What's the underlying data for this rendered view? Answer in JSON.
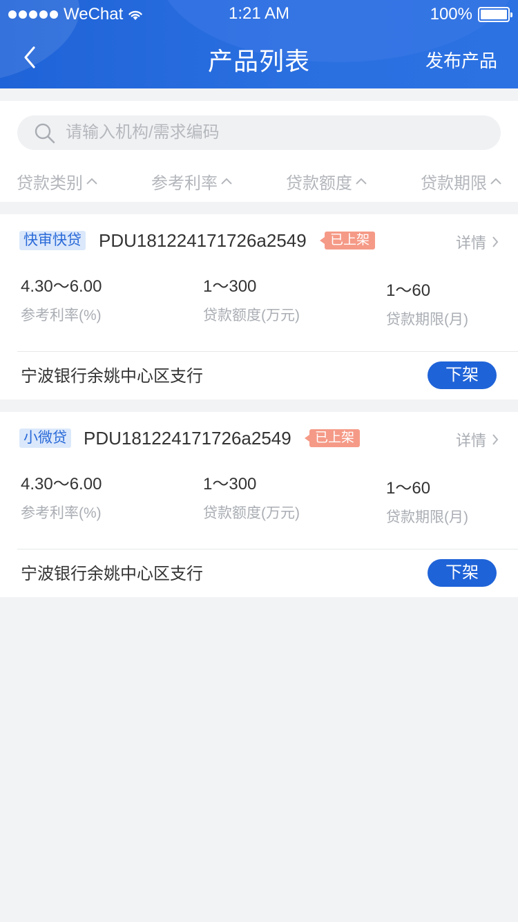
{
  "status_bar": {
    "carrier": "WeChat",
    "time": "1:21 AM",
    "battery": "100%"
  },
  "nav": {
    "title": "产品列表",
    "publish_label": "发布产品"
  },
  "search": {
    "placeholder": "请输入机构/需求编码"
  },
  "filters": [
    {
      "label": "贷款类别"
    },
    {
      "label": "参考利率"
    },
    {
      "label": "贷款额度"
    },
    {
      "label": "贷款期限"
    }
  ],
  "products": [
    {
      "type_tag": "快审快贷",
      "code": "PDU181224171726a2549",
      "status": "已上架",
      "detail_label": "详情",
      "rate": {
        "value": "4.30～6.00",
        "label": "参考利率(%)"
      },
      "amount": {
        "value": "1～300",
        "label": "贷款额度(万元)"
      },
      "term": {
        "value": "1～60",
        "label": "贷款期限(月)"
      },
      "bank": "宁波银行余姚中心区支行",
      "action_label": "下架"
    },
    {
      "type_tag": "小微贷",
      "code": "PDU181224171726a2549",
      "status": "已上架",
      "detail_label": "详情",
      "rate": {
        "value": "4.30～6.00",
        "label": "参考利率(%)"
      },
      "amount": {
        "value": "1～300",
        "label": "贷款额度(万元)"
      },
      "term": {
        "value": "1～60",
        "label": "贷款期限(月)"
      },
      "bank": "宁波银行余姚中心区支行",
      "action_label": "下架"
    }
  ]
}
